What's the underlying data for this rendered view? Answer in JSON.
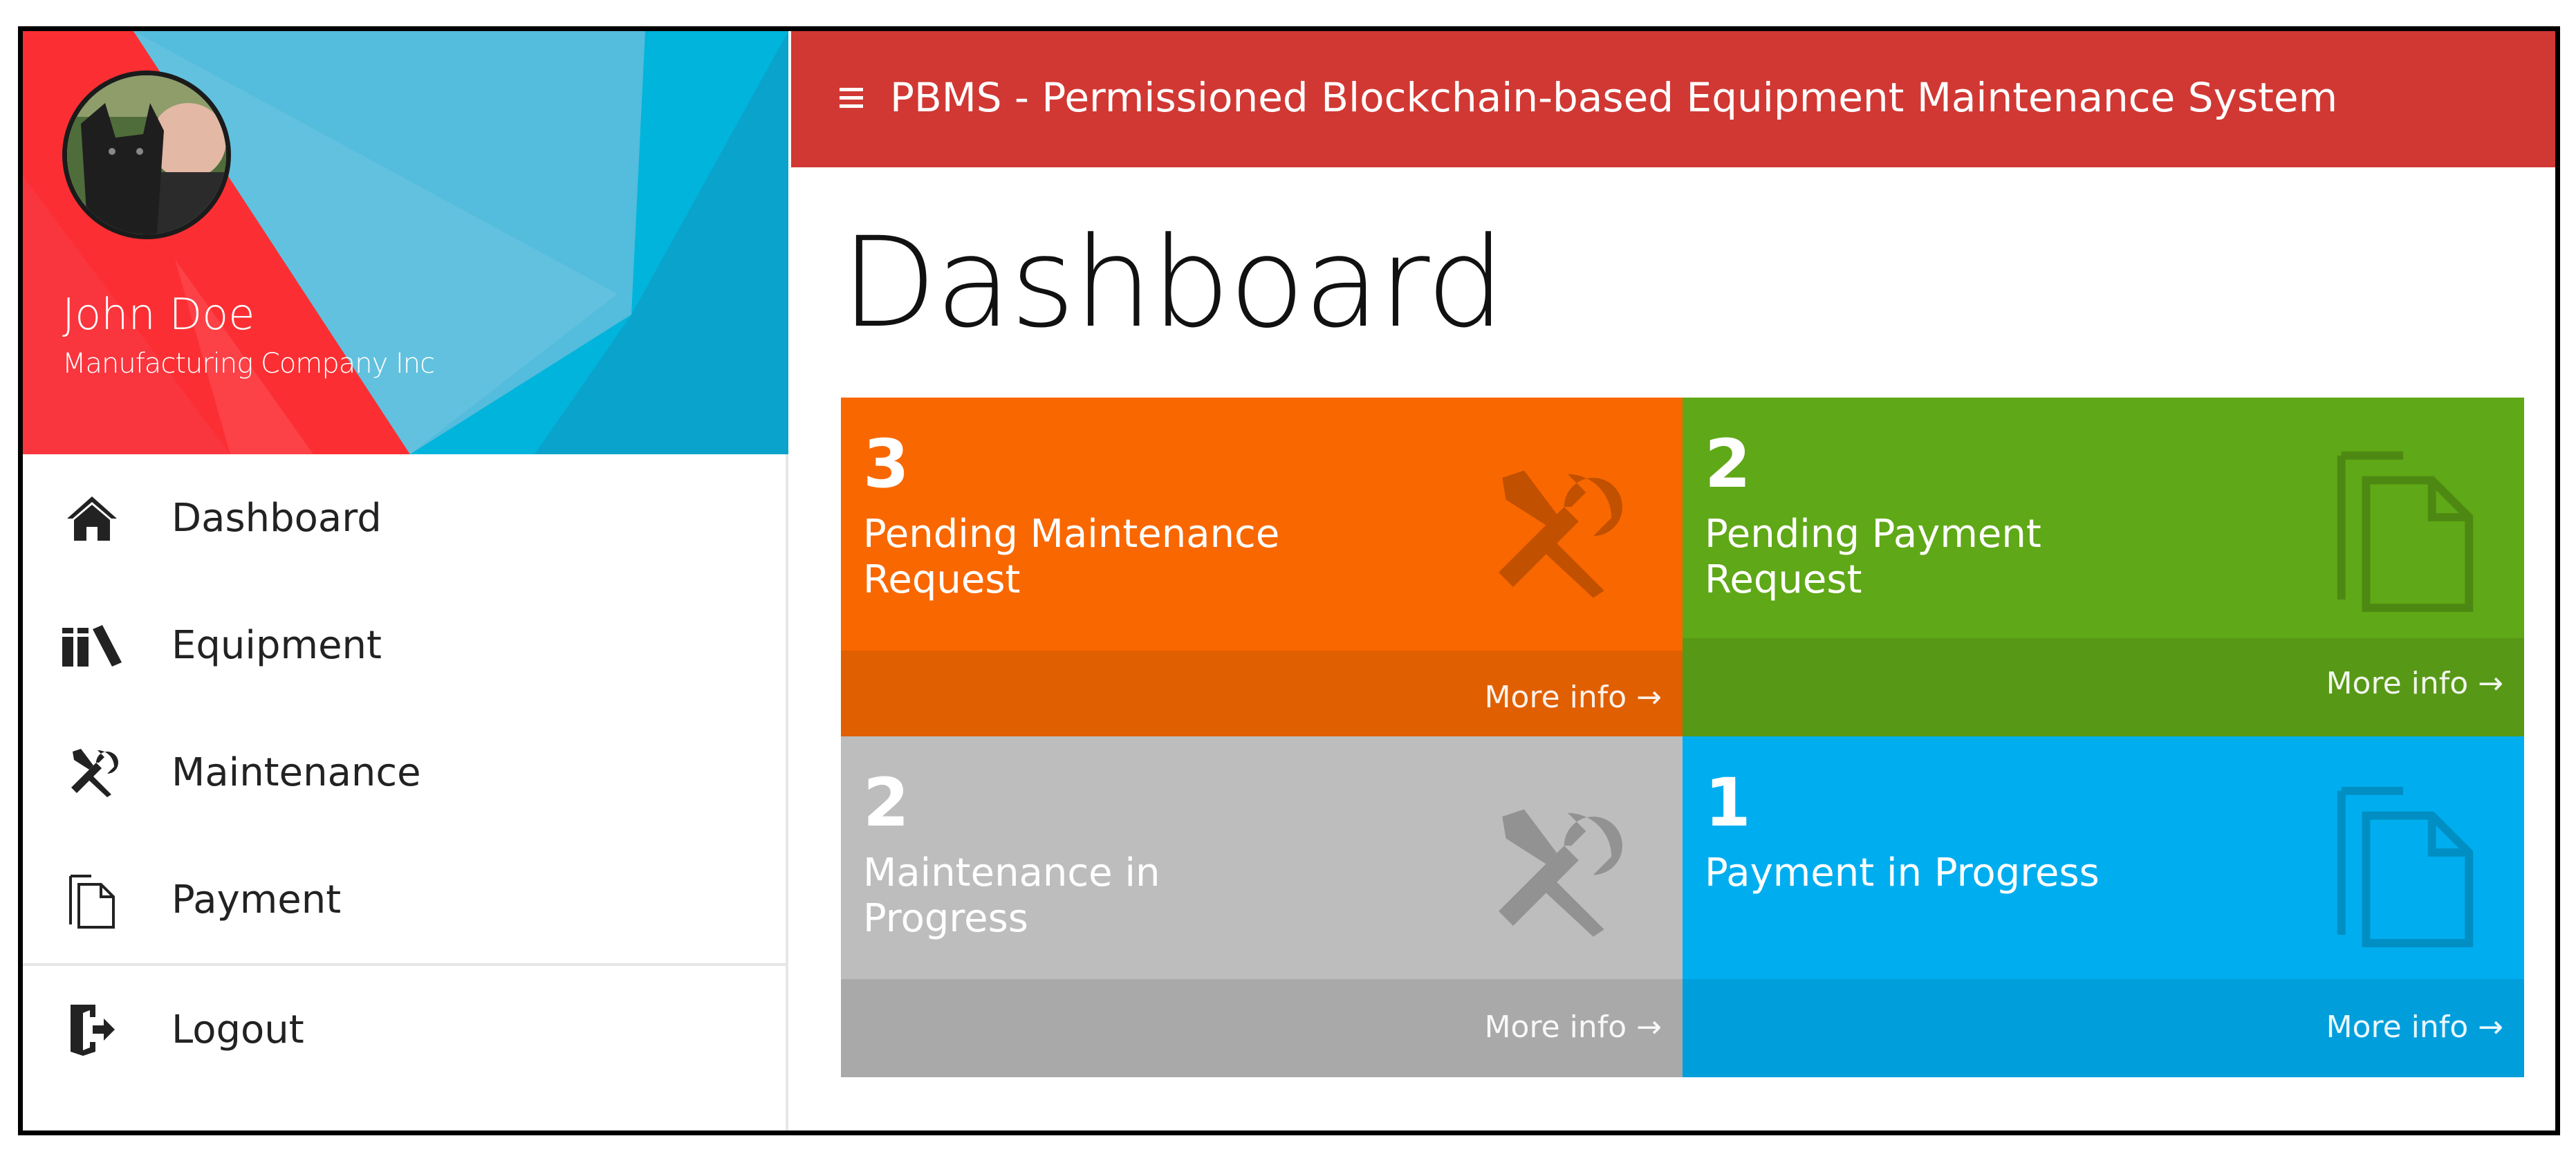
{
  "app": {
    "title": "PBMS - Permissioned Blockchain-based Equipment Maintenance System"
  },
  "user": {
    "name": "John Doe",
    "company": "Manufacturing Company Inc"
  },
  "sidebar": {
    "items": [
      {
        "label": "Dashboard",
        "icon": "home-icon"
      },
      {
        "label": "Equipment",
        "icon": "books-icon"
      },
      {
        "label": "Maintenance",
        "icon": "tools-icon"
      },
      {
        "label": "Payment",
        "icon": "documents-icon"
      },
      {
        "label": "Logout",
        "icon": "logout-icon"
      }
    ]
  },
  "page": {
    "title": "Dashboard"
  },
  "tiles": [
    {
      "count": "3",
      "label": "Pending Maintenance Request",
      "more": "More info →",
      "color": "#f96700",
      "footer_color": "#e05f00",
      "icon": "tools-icon"
    },
    {
      "count": "2",
      "label": "Pending Payment Request",
      "more": "More info →",
      "color": "#5fa817",
      "footer_color": "#579816",
      "icon": "documents-icon"
    },
    {
      "count": "2",
      "label": "Maintenance in Progress",
      "more": "More info →",
      "color": "#bdbdbd",
      "footer_color": "#a9a9a9",
      "icon": "tools-icon"
    },
    {
      "count": "1",
      "label": "Payment in Progress",
      "more": "More info →",
      "color": "#00aeef",
      "footer_color": "#009fdc",
      "icon": "documents-icon"
    }
  ],
  "colors": {
    "topbar": "#d13833",
    "profile_red": "#fb2f33",
    "profile_blue": "#00b4dc"
  }
}
